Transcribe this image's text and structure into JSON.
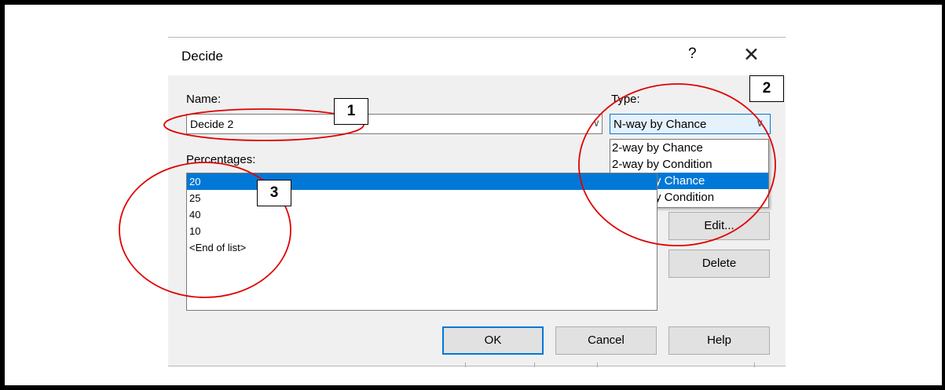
{
  "dialog": {
    "title": "Decide",
    "help_glyph": "?",
    "close_glyph": "✕"
  },
  "name": {
    "label": "Name:",
    "value": "Decide 2"
  },
  "type": {
    "label": "Type:",
    "selected": "N-way by Chance",
    "options": [
      "2-way by Chance",
      "2-way by Condition",
      "N-way by Chance",
      "N-way by Condition"
    ]
  },
  "percentages": {
    "label": "Percentages:",
    "items": [
      "20",
      "25",
      "40",
      "10",
      "<End of list>"
    ]
  },
  "buttons": {
    "edit": "Edit...",
    "delete": "Delete",
    "ok": "OK",
    "cancel": "Cancel",
    "help": "Help"
  },
  "callouts": [
    "1",
    "2",
    "3"
  ],
  "colors": {
    "accent": "#0078d7",
    "annotation": "#e00000",
    "dialog_bg": "#f0f0f0"
  }
}
